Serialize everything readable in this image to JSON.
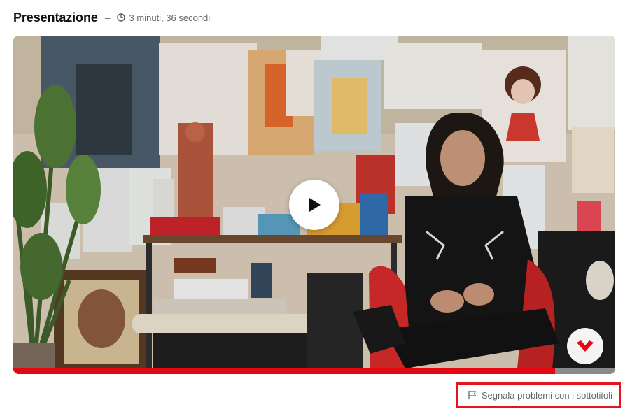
{
  "header": {
    "title": "Presentazione",
    "separator": "–",
    "duration_icon": "clock-icon",
    "duration": "3 minuti, 36 secondi"
  },
  "video": {
    "play_icon": "play-icon",
    "brand_icon": "domestika-logo-icon",
    "progress_fraction": 0.9,
    "accent_color": "#e30613"
  },
  "report": {
    "icon": "flag-icon",
    "label": "Segnala problemi con i sottotitoli",
    "highlight_color": "#e3141f"
  }
}
